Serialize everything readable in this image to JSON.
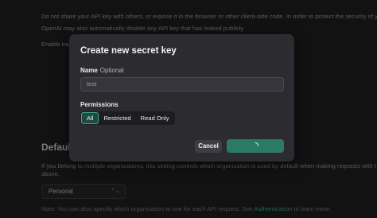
{
  "background": {
    "line_1": "Do not share your API key with others, or expose it in the browser or other client-side code. In order to protect the security of yo",
    "line_2": "OpenAI may also automatically disable any API key that has leaked publicly.",
    "line_3": "Enable tra",
    "default_heading": "Default",
    "default_desc_1": "If you belong to multiple organizations, this setting controls which organization is used by default when making requests with t",
    "default_desc_2": "above.",
    "org_select_value": "Personal",
    "note_prefix": "Note: You can also specify which organization to use for each API request. See ",
    "note_link": "Authentication",
    "note_suffix": " to learn more."
  },
  "modal": {
    "title": "Create new secret key",
    "name_label": "Name",
    "name_optional": "Optional",
    "name_value": "test",
    "permissions_label": "Permissions",
    "permissions": [
      {
        "label": "All",
        "active": true
      },
      {
        "label": "Restricted",
        "active": false
      },
      {
        "label": "Read Only",
        "active": false
      }
    ],
    "cancel_label": "Cancel",
    "create_state_icon": "spinner-icon"
  },
  "colors": {
    "accent": "#2a7a66",
    "accent_border": "#3fa98e",
    "link": "#3aa58a",
    "modal_bg": "#2b2b30"
  }
}
